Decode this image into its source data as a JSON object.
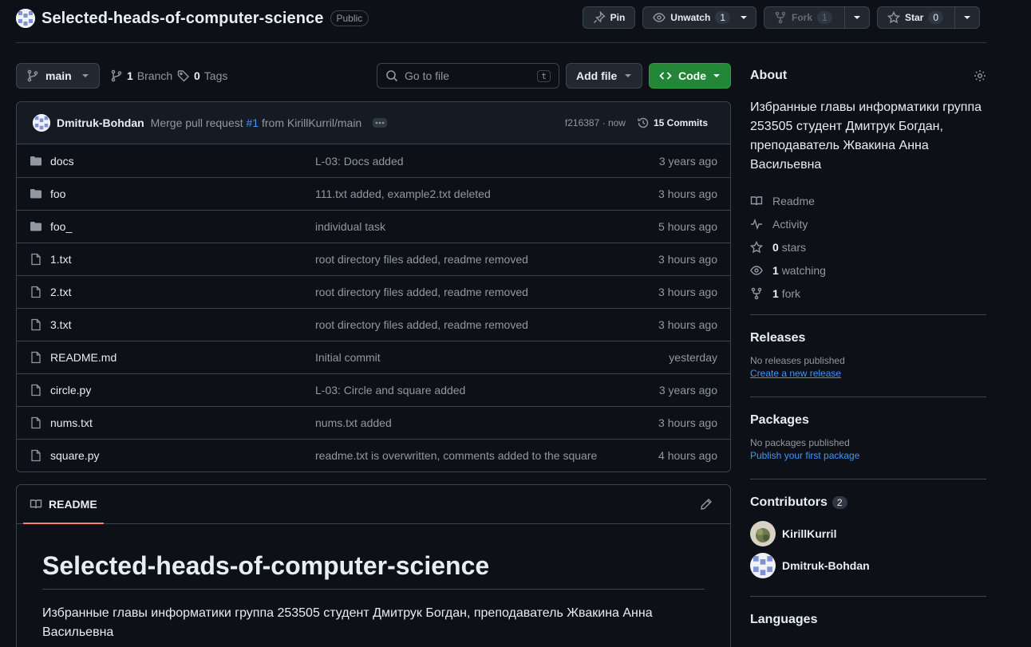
{
  "repo": {
    "name": "Selected-heads-of-computer-science",
    "visibility": "Public"
  },
  "actions": {
    "pin_label": "Pin",
    "unwatch_label": "Unwatch",
    "watch_count": "1",
    "fork_label": "Fork",
    "fork_count": "1",
    "star_label": "Star",
    "star_count": "0"
  },
  "toolbar": {
    "branch": "main",
    "branches_count": "1",
    "branches_label": "Branch",
    "tags_count": "0",
    "tags_label": "Tags",
    "search_placeholder": "Go to file",
    "search_shortcut": "t",
    "add_file_label": "Add file",
    "code_label": "Code"
  },
  "last_commit": {
    "author": "Dmitruk-Bohdan",
    "message_prefix": "Merge pull request",
    "pr": "#1",
    "message_suffix": "from KirillKurril/main",
    "hash_time": "f216387 · now",
    "commits_label": "15 Commits"
  },
  "files": [
    {
      "type": "dir",
      "name": "docs",
      "message": "L-03: Docs added",
      "age": "3 years ago"
    },
    {
      "type": "dir",
      "name": "foo",
      "message": "111.txt added, example2.txt deleted",
      "age": "3 hours ago"
    },
    {
      "type": "dir",
      "name": "foo_",
      "message": "individual task",
      "age": "5 hours ago"
    },
    {
      "type": "file",
      "name": "1.txt",
      "message": "root directory files added, readme removed",
      "age": "3 hours ago"
    },
    {
      "type": "file",
      "name": "2.txt",
      "message": "root directory files added, readme removed",
      "age": "3 hours ago"
    },
    {
      "type": "file",
      "name": "3.txt",
      "message": "root directory files added, readme removed",
      "age": "3 hours ago"
    },
    {
      "type": "file",
      "name": "README.md",
      "message": "Initial commit",
      "age": "yesterday"
    },
    {
      "type": "file",
      "name": "circle.py",
      "message": "L-03: Circle and square added",
      "age": "3 years ago"
    },
    {
      "type": "file",
      "name": "nums.txt",
      "message": "nums.txt added",
      "age": "3 hours ago"
    },
    {
      "type": "file",
      "name": "square.py",
      "message": "readme.txt is overwritten, comments added to the square",
      "age": "4 hours ago"
    }
  ],
  "readme": {
    "tab_label": "README",
    "heading": "Selected-heads-of-computer-science",
    "text": "Избранные главы информатики группа 253505 студент Дмитрук Богдан, преподаватель Жвакина Анна Васильевна"
  },
  "about": {
    "title": "About",
    "description": "Избранные главы информатики группа 253505 студент Дмитрук Богдан, преподаватель Жвакина Анна Васильевна",
    "readme_label": "Readme",
    "activity_label": "Activity",
    "stars_count": "0",
    "stars_label": "stars",
    "watching_count": "1",
    "watching_label": "watching",
    "fork_count": "1",
    "fork_label": "fork"
  },
  "releases": {
    "title": "Releases",
    "empty_text": "No releases published",
    "create_link": "Create a new release"
  },
  "packages": {
    "title": "Packages",
    "empty_text": "No packages published",
    "publish_link": "Publish your first package"
  },
  "contributors": {
    "title": "Contributors",
    "count": "2",
    "list": [
      {
        "name": "KirillKurril"
      },
      {
        "name": "Dmitruk-Bohdan"
      }
    ]
  },
  "languages": {
    "title": "Languages"
  },
  "colors": {
    "background": "#0d1117",
    "accent_link": "#4493f8",
    "code_button": "#238636",
    "tab_underline": "#f78166"
  }
}
